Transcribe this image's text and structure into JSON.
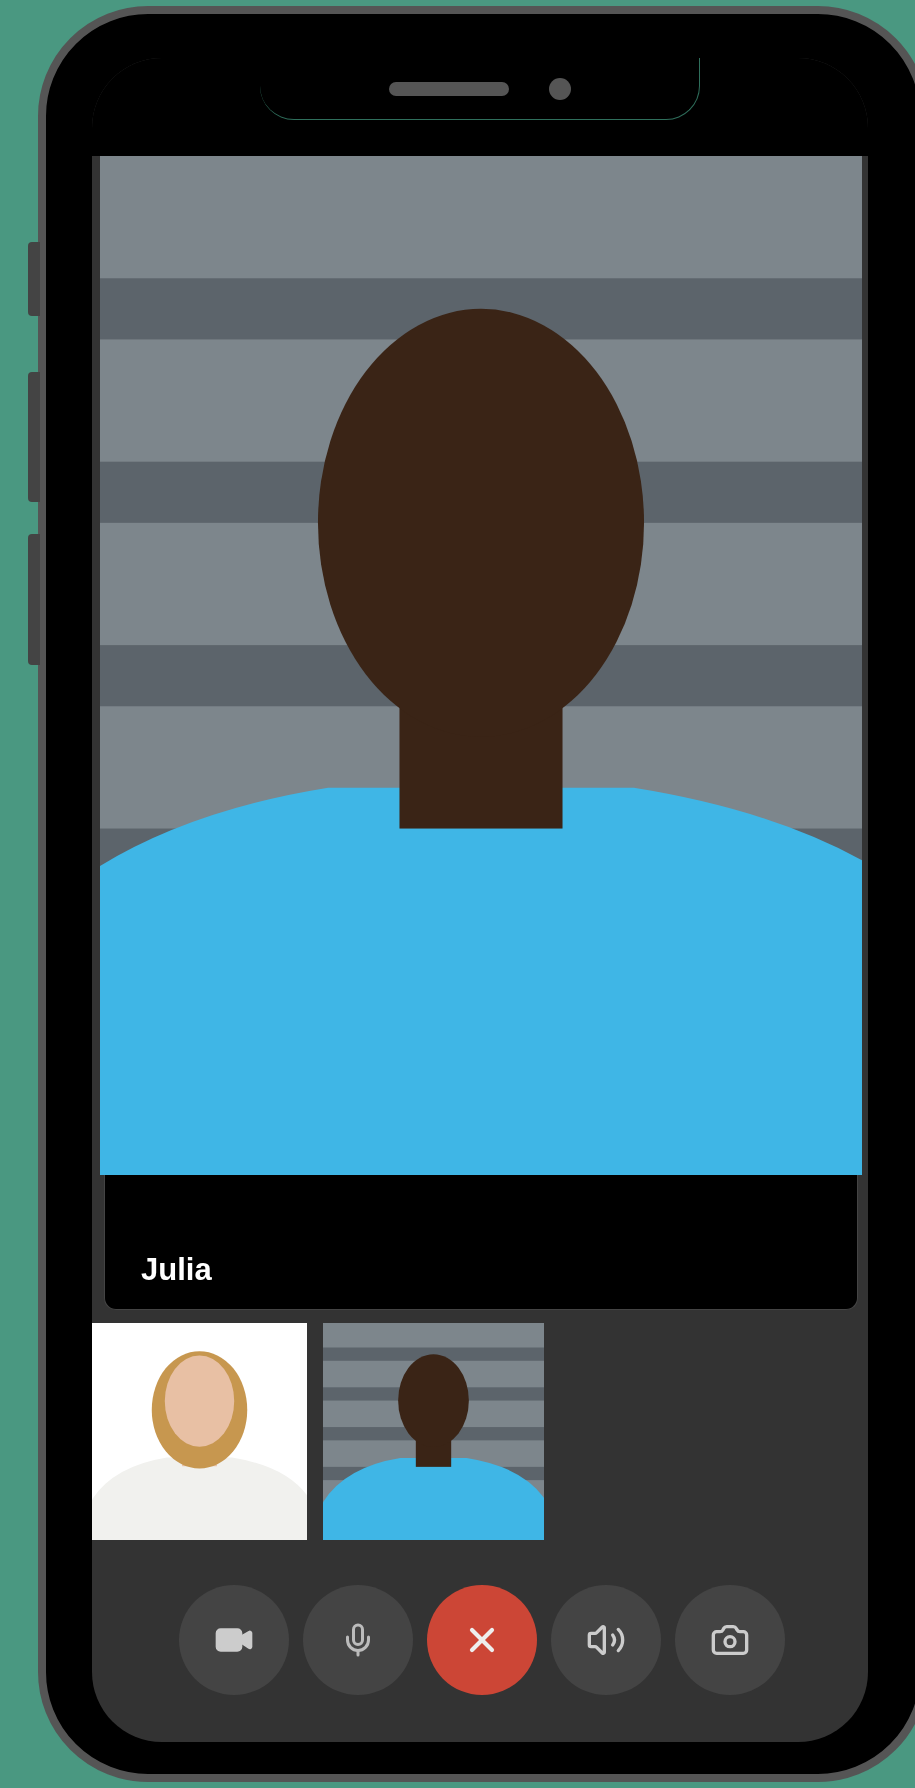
{
  "caller": {
    "name": "Julia"
  },
  "controls": [
    {
      "kind": "video"
    },
    {
      "kind": "mic"
    },
    {
      "kind": "end"
    },
    {
      "kind": "speaker"
    },
    {
      "kind": "camera"
    }
  ]
}
